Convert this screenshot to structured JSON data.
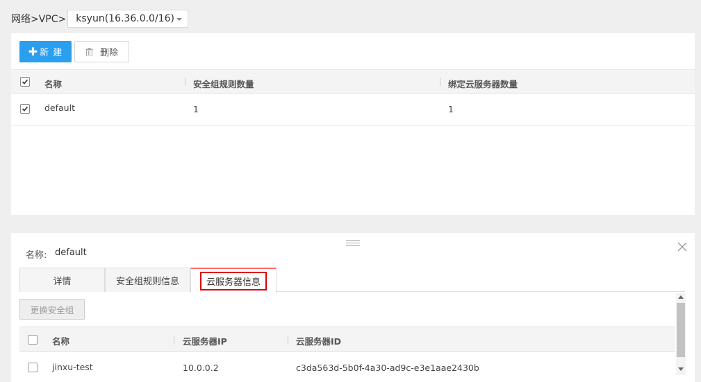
{
  "breadcrumb": {
    "prefix": "网络>VPC>",
    "vpc_selected": "ksyun(16.36.0.0/16)"
  },
  "toolbar": {
    "new_label": "新 建",
    "new_icon": "plus-icon",
    "delete_label": "删除",
    "delete_icon": "trash-icon"
  },
  "security_groups": {
    "columns": [
      "名称",
      "安全组规则数量",
      "绑定云服务器数量"
    ],
    "rows": [
      {
        "checked": true,
        "name": "default",
        "rule_count": "1",
        "server_count": "1"
      }
    ]
  },
  "detail": {
    "name_label": "名称:",
    "name_value": "default",
    "tabs": [
      {
        "label": "详情",
        "active": false
      },
      {
        "label": "安全组规则信息",
        "active": false
      },
      {
        "label": "云服务器信息",
        "active": true
      }
    ],
    "change_button": "更换安全组",
    "servers": {
      "columns": [
        "名称",
        "云服务器IP",
        "云服务器ID"
      ],
      "rows": [
        {
          "checked": false,
          "name": "jinxu-test",
          "ip": "10.0.0.2",
          "id": "c3da563d-5b0f-4a30-ad9c-e3e1aae2430b"
        }
      ]
    }
  },
  "colors": {
    "primary": "#2a9ff0",
    "tab_accent": "#ff6b6b",
    "highlight_box": "#dd0000"
  }
}
